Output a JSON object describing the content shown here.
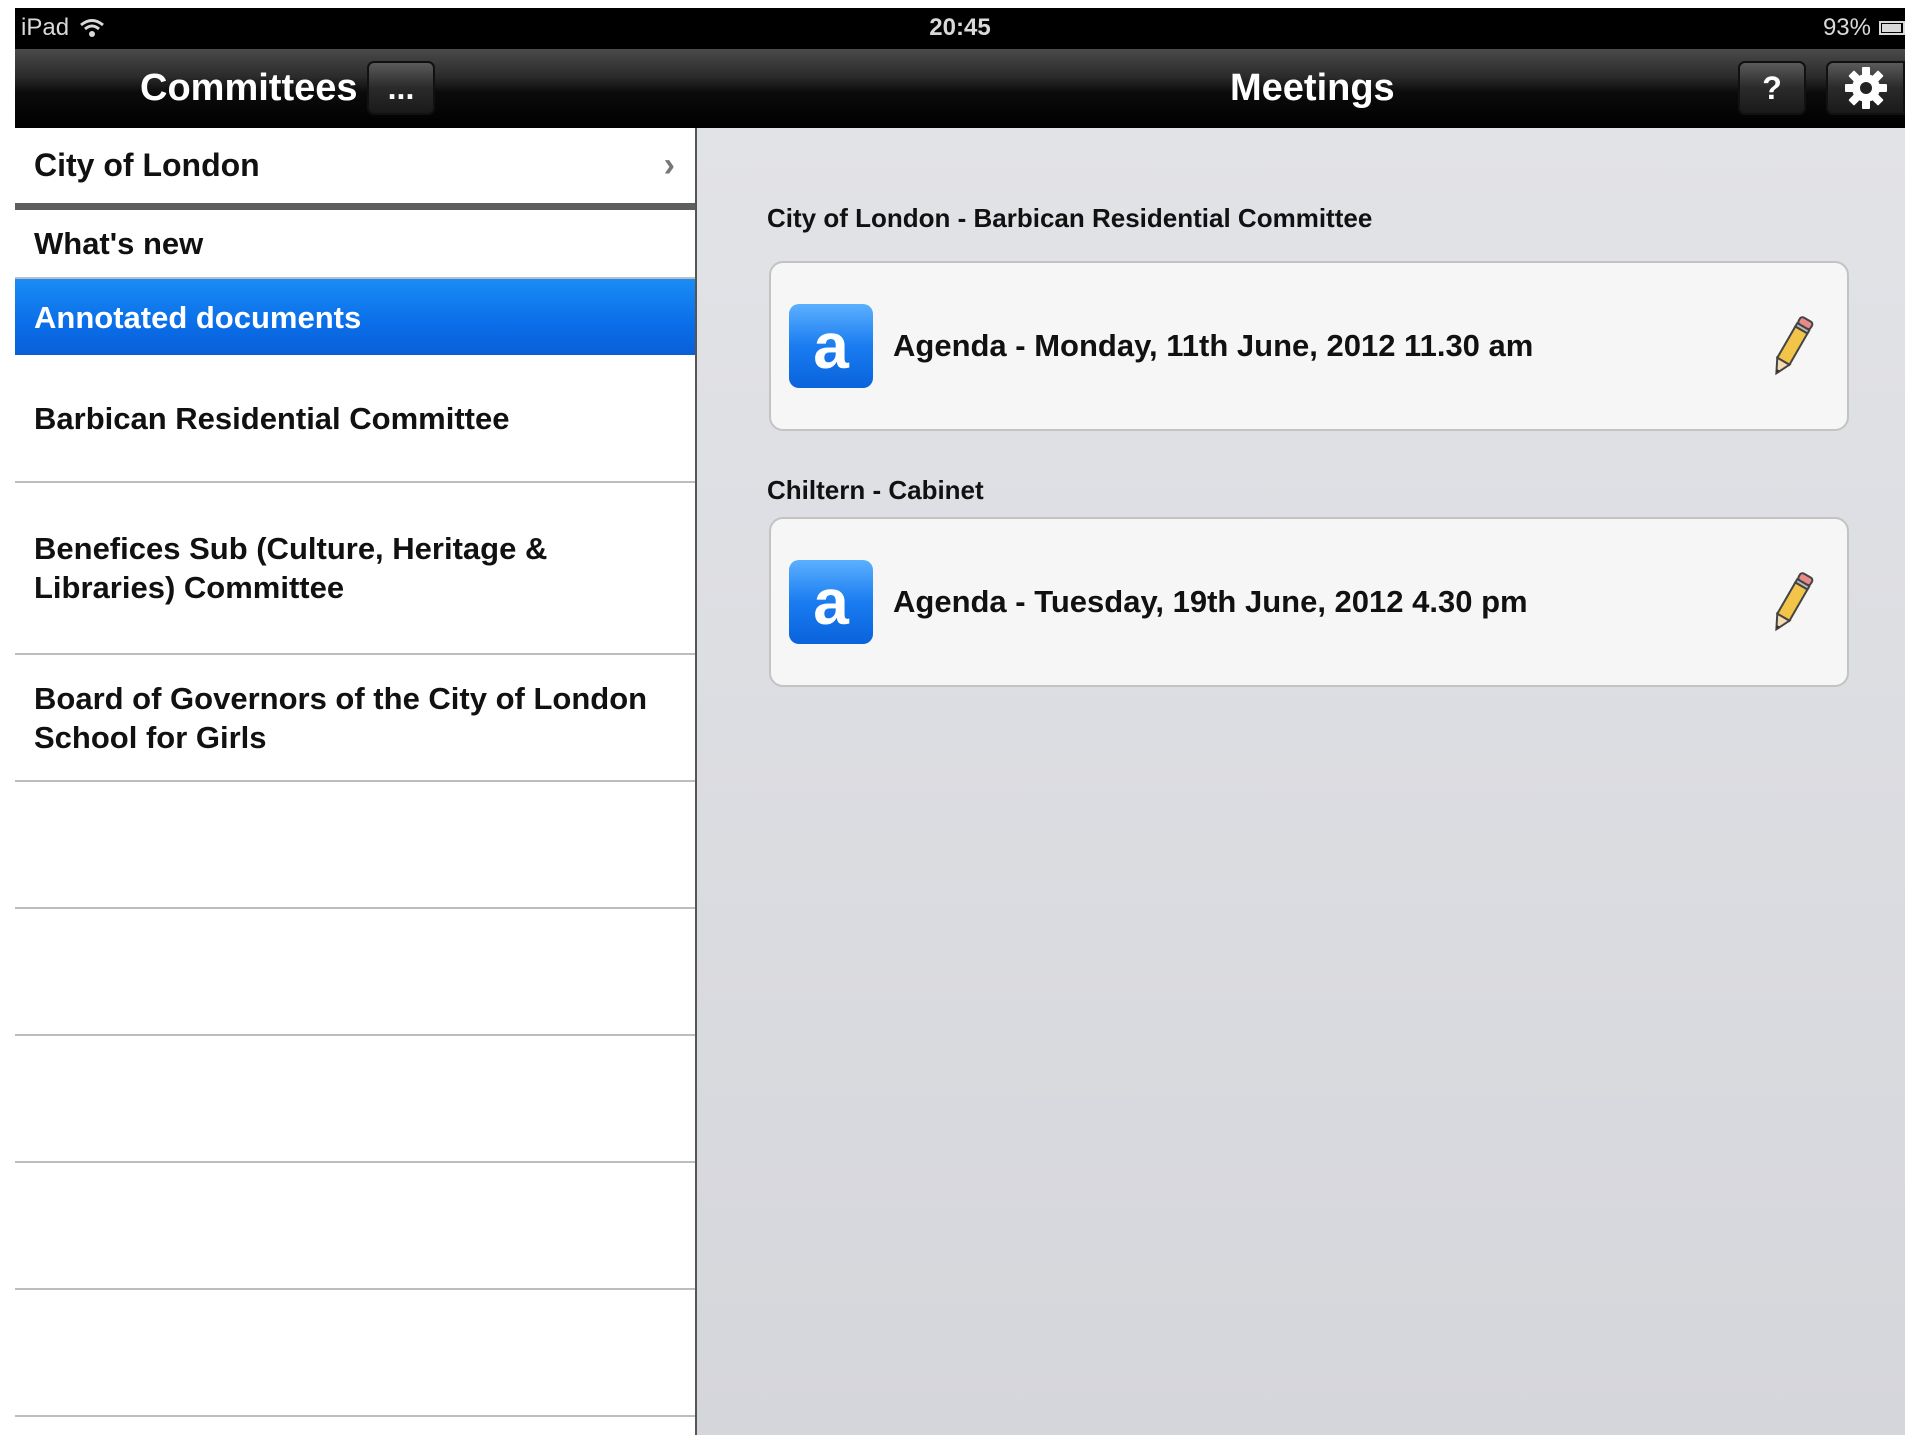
{
  "status_bar": {
    "device": "iPad",
    "time": "20:45",
    "battery": "93%",
    "icons": [
      "wifi-icon",
      "battery-icon"
    ]
  },
  "nav_bar": {
    "left_title": "Committees",
    "more_button": "...",
    "center_title": "Meetings",
    "help_button": "?",
    "settings_icon": "gear-icon"
  },
  "sidebar": {
    "header": "City of London",
    "items": [
      {
        "label": "What's new",
        "selected": false
      },
      {
        "label": "Annotated documents",
        "selected": true
      },
      {
        "label": "Barbican Residential Committee",
        "selected": false
      },
      {
        "label": "Benefices Sub (Culture, Heritage & Libraries) Committee",
        "selected": false
      },
      {
        "label": "Board of Governors of the City of London School for Girls",
        "selected": false
      }
    ]
  },
  "meetings": [
    {
      "section": "City of London - Barbican Residential Committee",
      "icon_letter": "a",
      "label": "Agenda - Monday, 11th June, 2012 11.30 am"
    },
    {
      "section": "Chiltern - Cabinet",
      "icon_letter": "a",
      "label": "Agenda - Tuesday, 19th June, 2012 4.30 pm"
    }
  ],
  "colors": {
    "selection": "#0a6ee8",
    "detail_background": "#dcdde1",
    "app_icon": "#1a7cf0"
  }
}
